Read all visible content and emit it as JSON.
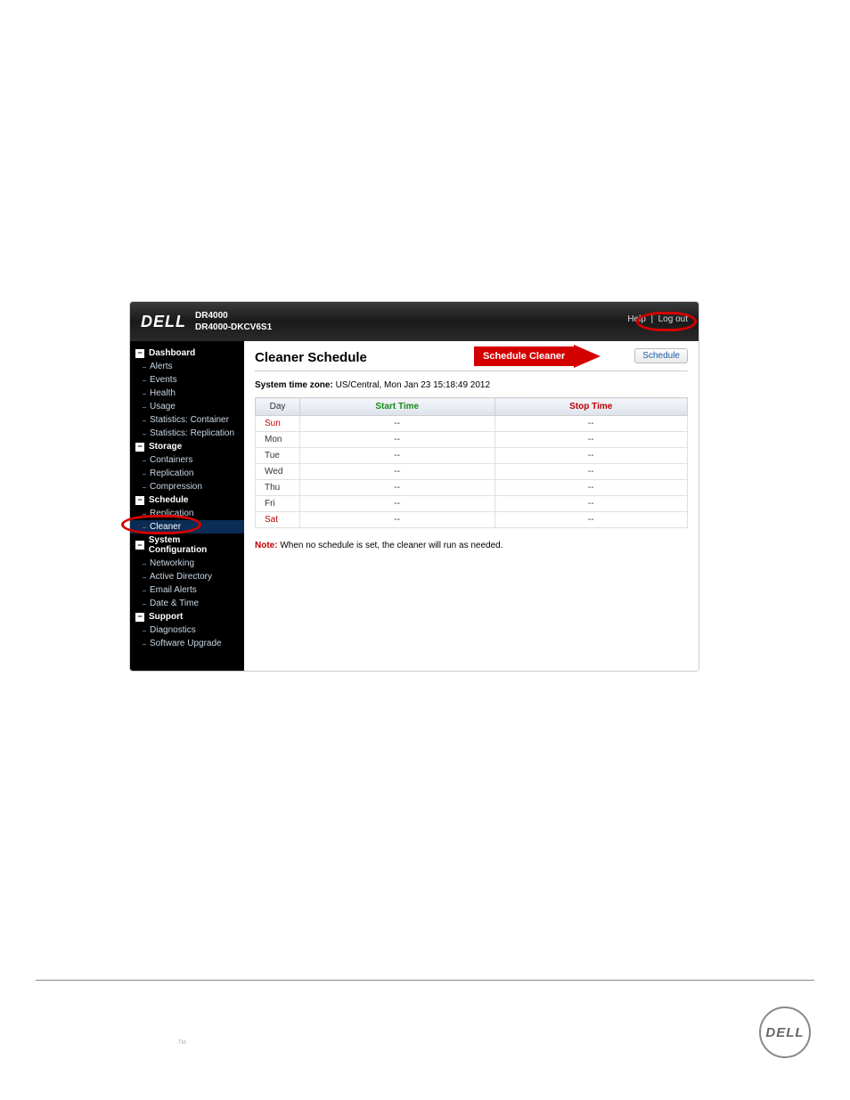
{
  "header": {
    "brand": "DELL",
    "product": "DR4000",
    "hostname": "DR4000-DKCV6S1",
    "links": {
      "help": "Help",
      "logout": "Log out"
    }
  },
  "sidebar": {
    "groups": [
      {
        "label": "Dashboard",
        "items": [
          "Alerts",
          "Events",
          "Health",
          "Usage",
          "Statistics: Container",
          "Statistics: Replication"
        ]
      },
      {
        "label": "Storage",
        "items": [
          "Containers",
          "Replication",
          "Compression"
        ]
      },
      {
        "label": "Schedule",
        "items": [
          "Replication",
          "Cleaner"
        ],
        "selected": "Cleaner"
      },
      {
        "label": "System Configuration",
        "items": [
          "Networking",
          "Active Directory",
          "Email Alerts",
          "Date & Time"
        ]
      },
      {
        "label": "Support",
        "items": [
          "Diagnostics",
          "Software Upgrade"
        ]
      }
    ]
  },
  "content": {
    "title": "Cleaner Schedule",
    "callout": "Schedule Cleaner",
    "schedule_button": "Schedule",
    "timezone_label": "System time zone:",
    "timezone_value": "US/Central, Mon Jan 23 15:18:49 2012",
    "columns": {
      "day": "Day",
      "start": "Start Time",
      "stop": "Stop Time"
    },
    "rows": [
      {
        "day": "Sun",
        "weekend": true,
        "start": "--",
        "stop": "--"
      },
      {
        "day": "Mon",
        "weekend": false,
        "start": "--",
        "stop": "--"
      },
      {
        "day": "Tue",
        "weekend": false,
        "start": "--",
        "stop": "--"
      },
      {
        "day": "Wed",
        "weekend": false,
        "start": "--",
        "stop": "--"
      },
      {
        "day": "Thu",
        "weekend": false,
        "start": "--",
        "stop": "--"
      },
      {
        "day": "Fri",
        "weekend": false,
        "start": "--",
        "stop": "--"
      },
      {
        "day": "Sat",
        "weekend": true,
        "start": "--",
        "stop": "--"
      }
    ],
    "note_label": "Note:",
    "note_text": "When no schedule is set, the cleaner will run as needed."
  },
  "footer": {
    "logo": "DELL",
    "tm": "TM"
  }
}
